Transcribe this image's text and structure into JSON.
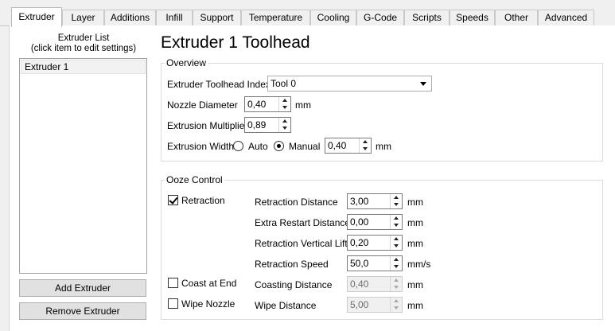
{
  "tabs": [
    {
      "label": "Extruder",
      "active": true
    },
    {
      "label": "Layer",
      "active": false
    },
    {
      "label": "Additions",
      "active": false
    },
    {
      "label": "Infill",
      "active": false
    },
    {
      "label": "Support",
      "active": false
    },
    {
      "label": "Temperature",
      "active": false
    },
    {
      "label": "Cooling",
      "active": false
    },
    {
      "label": "G-Code",
      "active": false
    },
    {
      "label": "Scripts",
      "active": false
    },
    {
      "label": "Speeds",
      "active": false
    },
    {
      "label": "Other",
      "active": false
    },
    {
      "label": "Advanced",
      "active": false
    }
  ],
  "extruder_list": {
    "title_line1": "Extruder List",
    "title_line2": "(click item to edit settings)",
    "items": [
      "Extruder 1"
    ],
    "add_button": "Add Extruder",
    "remove_button": "Remove Extruder"
  },
  "main": {
    "title": "Extruder 1 Toolhead"
  },
  "overview": {
    "legend": "Overview",
    "toolhead_index_label": "Extruder Toolhead Index",
    "toolhead_index_value": "Tool 0",
    "nozzle_label": "Nozzle Diameter",
    "nozzle_value": "0,40",
    "nozzle_unit": "mm",
    "multiplier_label": "Extrusion Multiplier",
    "multiplier_value": "0,89",
    "width_label": "Extrusion Width",
    "width_auto_label": "Auto",
    "width_auto_selected": false,
    "width_manual_label": "Manual",
    "width_manual_selected": true,
    "width_value": "0,40",
    "width_unit": "mm"
  },
  "ooze": {
    "legend": "Ooze Control",
    "retraction_label": "Retraction",
    "retraction_checked": true,
    "coast_label": "Coast at End",
    "coast_checked": false,
    "wipe_label": "Wipe Nozzle",
    "wipe_checked": false,
    "fields": [
      {
        "label": "Retraction Distance",
        "value": "3,00",
        "unit": "mm",
        "enabled": true
      },
      {
        "label": "Extra Restart Distance",
        "value": "0,00",
        "unit": "mm",
        "enabled": true
      },
      {
        "label": "Retraction Vertical Lift",
        "value": "0,20",
        "unit": "mm",
        "enabled": true
      },
      {
        "label": "Retraction Speed",
        "value": "50,0",
        "unit": "mm/s",
        "enabled": true
      },
      {
        "label": "Coasting Distance",
        "value": "0,40",
        "unit": "mm",
        "enabled": false
      },
      {
        "label": "Wipe Distance",
        "value": "5,00",
        "unit": "mm",
        "enabled": false
      }
    ]
  }
}
